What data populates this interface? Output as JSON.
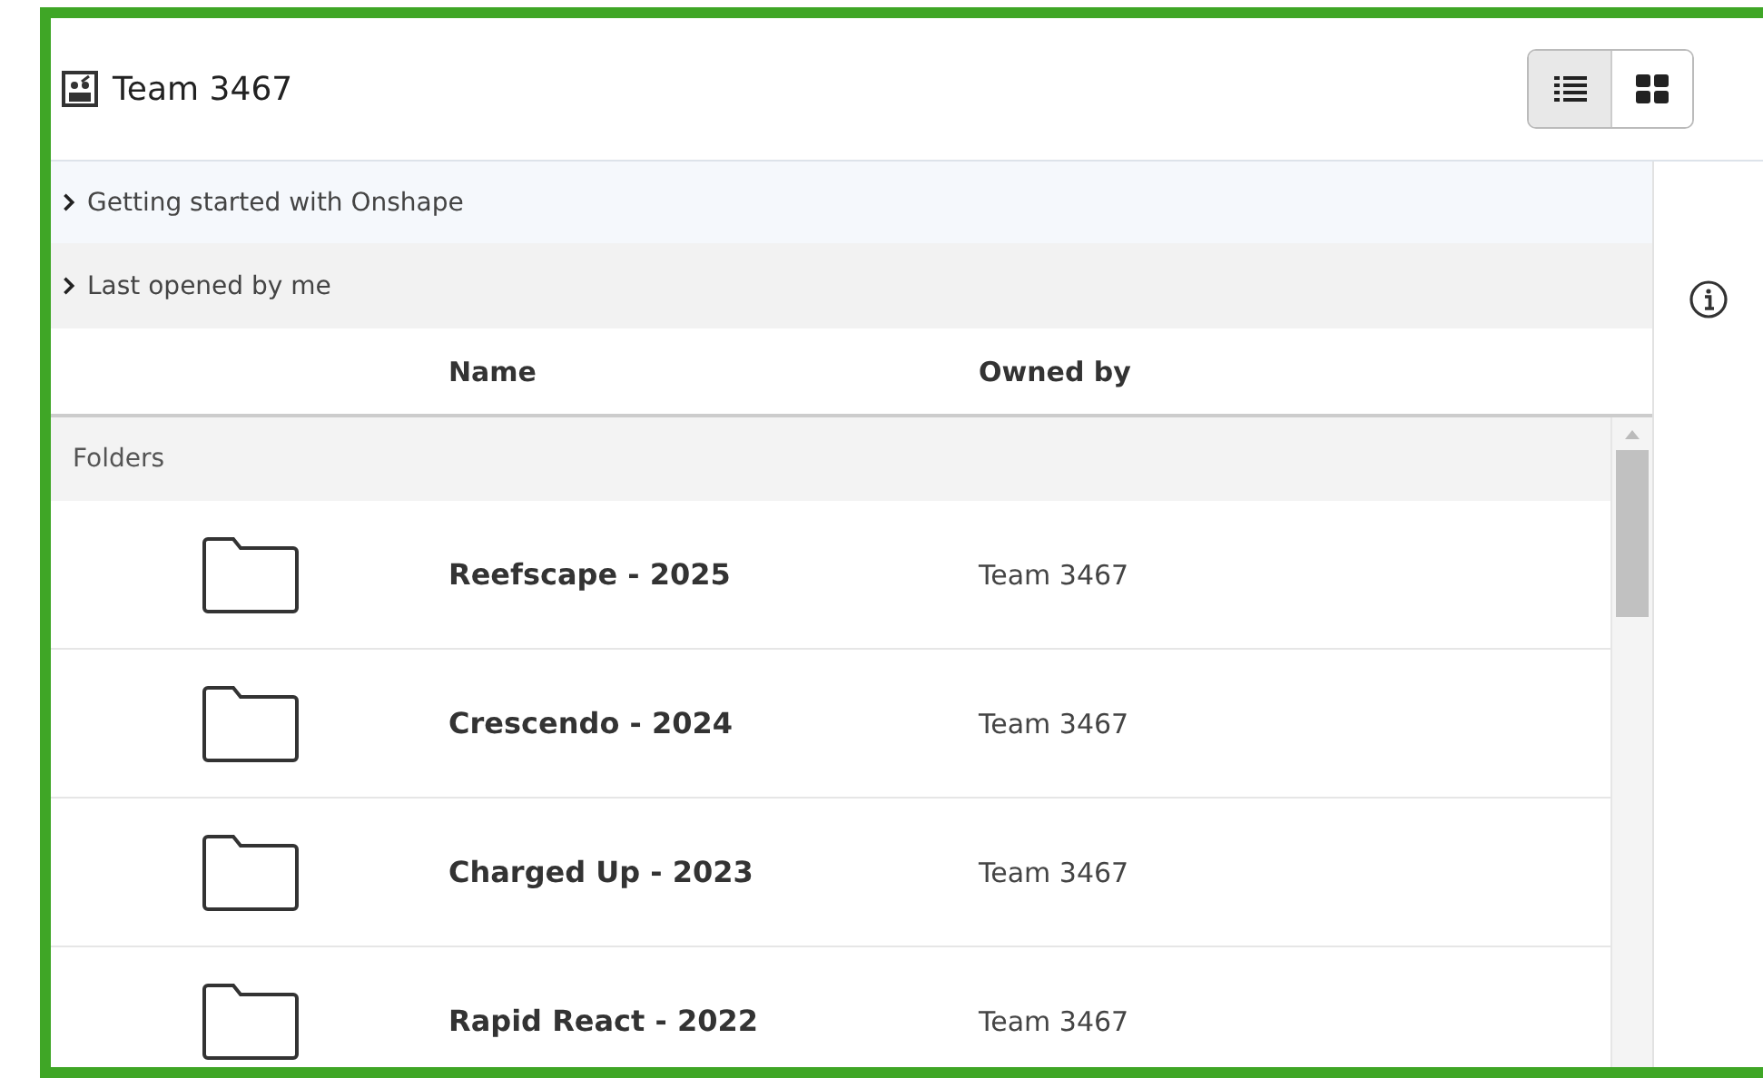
{
  "header": {
    "title": "Team 3467",
    "view_buttons": [
      {
        "kind": "list",
        "selected": true
      },
      {
        "kind": "grid",
        "selected": false
      }
    ]
  },
  "sections": [
    {
      "label": "Getting started with Onshape",
      "expanded": false
    },
    {
      "label": "Last opened by me",
      "expanded": false
    }
  ],
  "table": {
    "columns": [
      "Name",
      "Owned by"
    ],
    "group": "Folders",
    "rows": [
      {
        "name": "Reefscape - 2025",
        "owner": "Team 3467"
      },
      {
        "name": "Crescendo - 2024",
        "owner": "Team 3467"
      },
      {
        "name": "Charged Up - 2023",
        "owner": "Team 3467"
      },
      {
        "name": "Rapid React - 2022",
        "owner": "Team 3467"
      }
    ]
  }
}
